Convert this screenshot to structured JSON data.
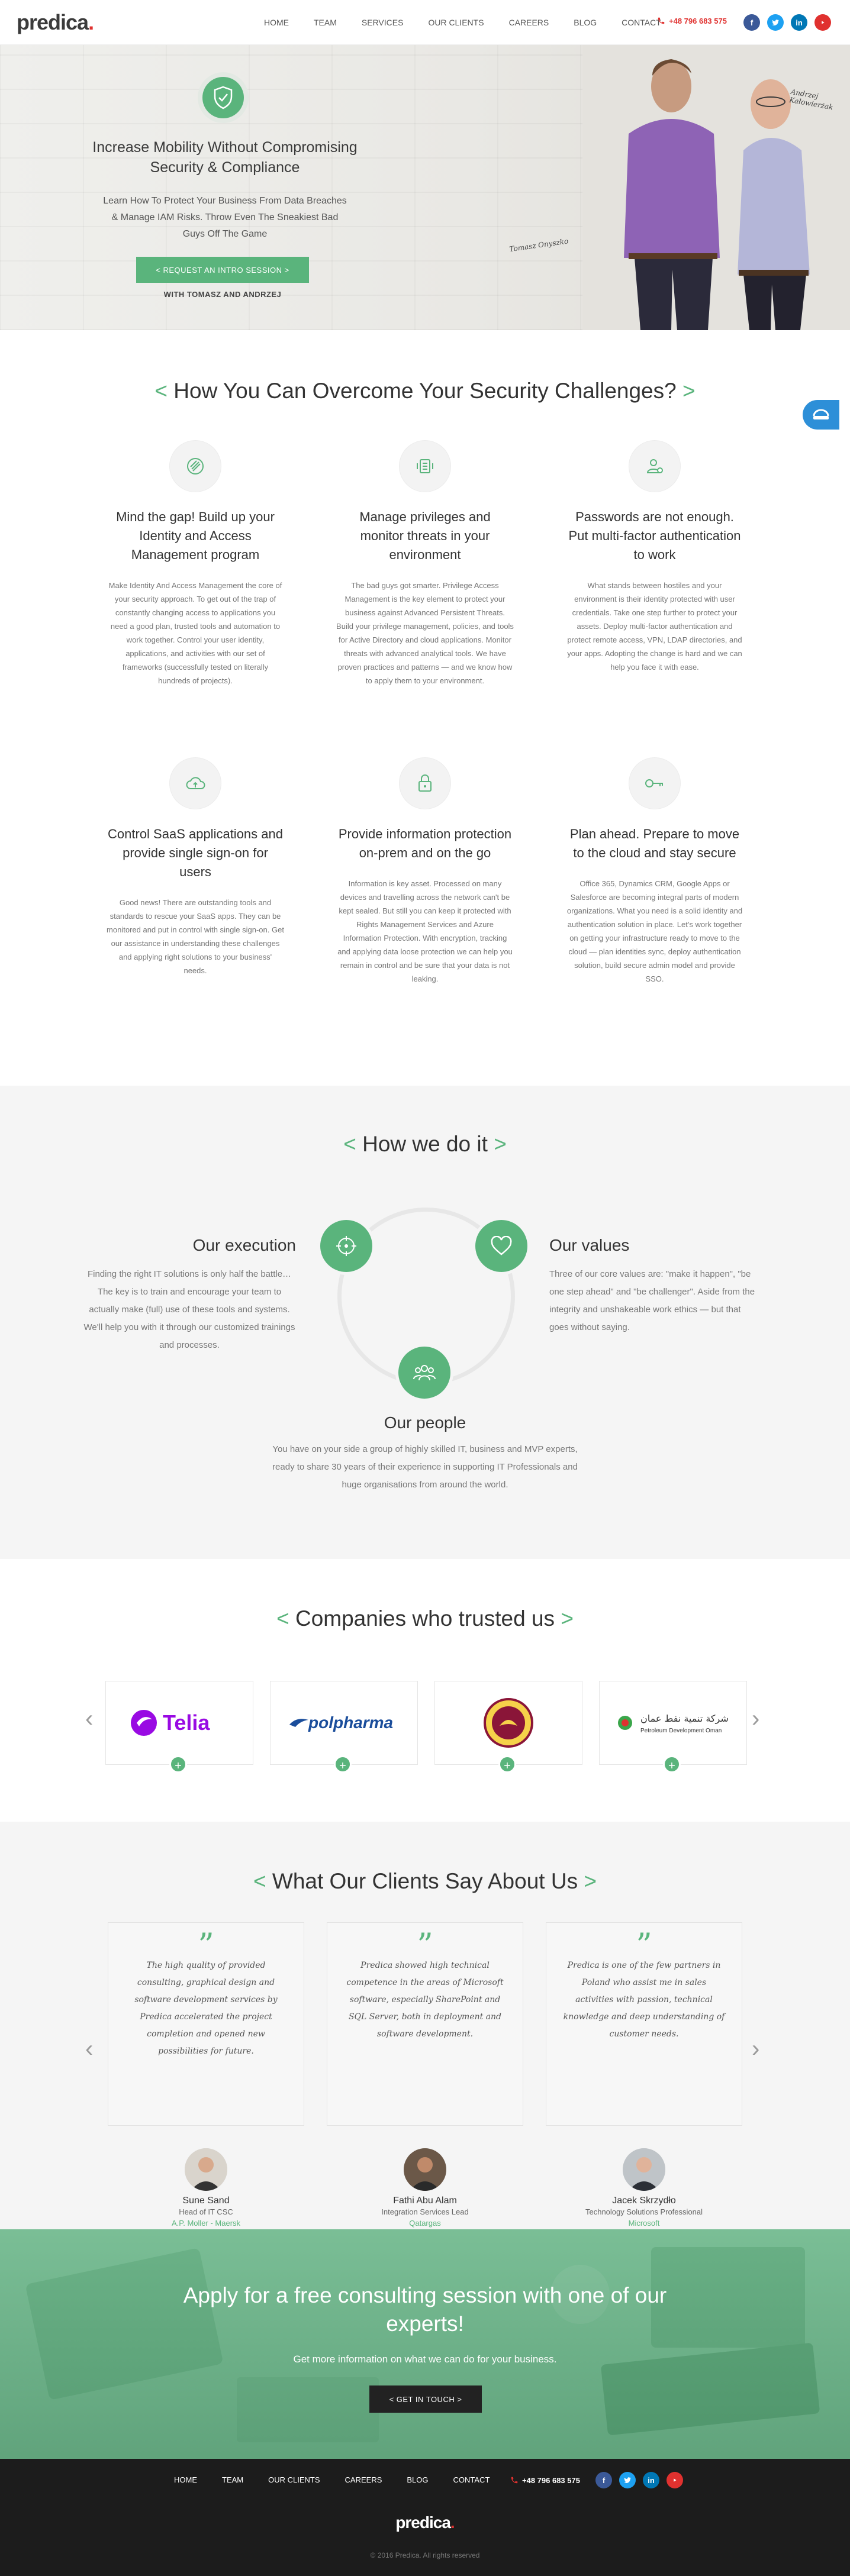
{
  "brand": {
    "logo_text": "predica",
    "logo_dot": ".",
    "accent": "#5ab47c",
    "red": "#e0312f"
  },
  "header": {
    "nav": [
      "HOME",
      "TEAM",
      "SERVICES",
      "OUR CLIENTS",
      "CAREERS",
      "BLOG",
      "CONTACT"
    ],
    "phone": "+48 796 683 575",
    "social_icons": [
      "facebook-icon",
      "twitter-icon",
      "linkedin-icon",
      "youtube-icon"
    ]
  },
  "hero": {
    "title": "Increase Mobility Without Compromising Security & Compliance",
    "text": "Learn How To Protect Your Business From Data Breaches & Manage IAM Risks. Throw Even The Sneakiest Bad Guys Off The Game",
    "button": "< REQUEST AN INTRO SESSION >",
    "with": "WITH TOMASZ AND ANDRZEJ",
    "annotation_1": "Andrzej Kałowierżak",
    "annotation_2": "Tomasz Onyszko"
  },
  "challenges": {
    "title_left": "<",
    "title": "How You Can Overcome Your Security Challenges?",
    "title_right": ">",
    "items": [
      {
        "icon": "fingerprint-icon",
        "heading": "Mind the gap! Build up your Identity and Access Management program",
        "text": "Make Identity And Access Management the core of your security approach. To get out of the trap of constantly changing access to applications you need a good plan, trusted tools and automation to work together. Control your user identity, applications, and activities with our set of frameworks (successfully tested on literally hundreds of projects)."
      },
      {
        "icon": "monitor-device-icon",
        "heading": "Manage privileges and monitor threats in your environment",
        "text": "The bad guys got smarter. Privilege Access Management is the key element to protect your business against Advanced Persistent Threats. Build your privilege management, policies, and tools for Active Directory and cloud applications. Monitor threats with advanced analytical tools. We have proven practices and patterns — and we know how to apply them to your environment."
      },
      {
        "icon": "user-auth-icon",
        "heading": "Passwords are not enough. Put multi-factor authentication to work",
        "text": "What stands between hostiles and your environment is their identity protected with user credentials. Take one step further to protect your assets. Deploy multi-factor authentication and protect remote access, VPN, LDAP directories, and your apps. Adopting the change is hard and we can help you face it with ease."
      },
      {
        "icon": "cloud-icon",
        "heading": "Control SaaS applications and provide single sign-on for users",
        "text": "Good news! There are outstanding tools and standards to rescue your SaaS apps. They can be monitored and put in control with single sign-on. Get our assistance in understanding these challenges and applying right solutions to your business' needs."
      },
      {
        "icon": "lock-icon",
        "heading": "Provide information protection on-prem and on the go",
        "text": "Information is key asset. Processed on many devices and travelling across the network can't be kept sealed. But still you can keep it protected with Rights Management Services and Azure Information Protection. With encryption, tracking and applying data loose protection we can help you remain in control and be sure that your data is not leaking."
      },
      {
        "icon": "key-icon",
        "heading": "Plan ahead. Prepare to move to the cloud and stay secure",
        "text": "Office 365, Dynamics CRM, Google Apps or Salesforce are becoming integral parts of modern organizations. What you need is a solid identity and authentication solution in place. Let's work together on getting your infrastructure ready to move to the cloud — plan identities sync, deploy authentication solution, build secure admin model and provide SSO."
      }
    ]
  },
  "how": {
    "title_left": "<",
    "title": "How we do it",
    "title_right": ">",
    "execution": {
      "heading": "Our execution",
      "text": "Finding the right IT solutions is only half the battle… The key is to train and encourage your team to actually make (full) use of these tools and systems. We'll help you with it through our customized trainings and processes."
    },
    "values": {
      "heading": "Our values",
      "text": "Three of our core values are: \"make it happen\", \"be one step ahead\" and \"be challenger\". Aside from the integrity and unshakeable work ethics — but that goes without saying."
    },
    "people": {
      "heading": "Our people",
      "text": "You have on your side a group of highly skilled IT, business and MVP experts, ready to share 30 years of their experience in supporting IT Professionals and huge organisations from around the world."
    }
  },
  "companies": {
    "title_left": "<",
    "title": "Companies who trusted us",
    "title_right": ">",
    "logos": [
      "Telia",
      "polpharma",
      "Qatar emblem",
      "Petroleum Development Oman"
    ],
    "plus": "+",
    "prev": "‹",
    "next": "›"
  },
  "testimonials": {
    "title_left": "<",
    "title": "What Our Clients Say About Us",
    "title_right": ">",
    "quote_mark": "”",
    "items": [
      {
        "quote": "The high quality of provided consulting, graphical design and software development services by Predica accelerated the project completion and opened new possibilities for future.",
        "name": "Sune Sand",
        "role": "Head of IT CSC",
        "company": "A.P. Moller - Maersk"
      },
      {
        "quote": "Predica showed high technical competence in the areas of Microsoft software, especially SharePoint and SQL Server, both in deployment and software development.",
        "name": "Fathi Abu Alam",
        "role": "Integration Services Lead",
        "company": "Qatargas"
      },
      {
        "quote": "Predica is one of the few partners in Poland who assist me in sales activities with passion, technical knowledge and deep understanding of customer needs.",
        "name": "Jacek Skrzydło",
        "role": "Technology Solutions Professional",
        "company": "Microsoft"
      }
    ]
  },
  "cta": {
    "title": "Apply for a free consulting session with one of our experts!",
    "text": "Get more information on what we can do for your business.",
    "button": "< GET IN TOUCH >"
  },
  "footer": {
    "nav": [
      "HOME",
      "TEAM",
      "OUR CLIENTS",
      "CAREERS",
      "BLOG",
      "CONTACT"
    ],
    "phone": "+48 796 683 575",
    "logo_text": "predica",
    "logo_dot": ".",
    "copyright": "© 2016 Predica. All rights reserved"
  }
}
